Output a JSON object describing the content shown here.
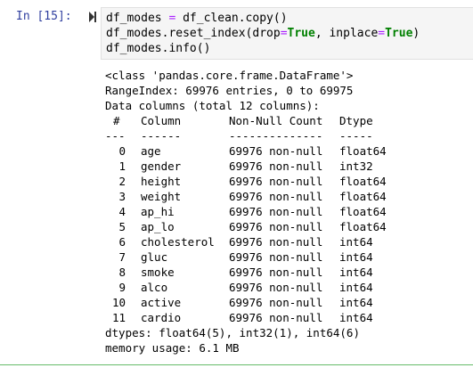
{
  "cell": {
    "prompt": "In [15]:",
    "code_lines": [
      "df_modes = df_clean.copy()",
      "df_modes.reset_index(drop=True, inplace=True)",
      "df_modes.info()"
    ]
  },
  "output": {
    "header_lines": [
      "<class 'pandas.core.frame.DataFrame'>",
      "RangeIndex: 69976 entries, 0 to 69975",
      "Data columns (total 12 columns):"
    ],
    "table": {
      "headers": [
        "#",
        "Column",
        "Non-Null Count",
        "Dtype"
      ],
      "separators": [
        "---",
        "------",
        "--------------",
        "-----"
      ],
      "rows": [
        [
          "0",
          "age",
          "69976 non-null",
          "float64"
        ],
        [
          "1",
          "gender",
          "69976 non-null",
          "int32"
        ],
        [
          "2",
          "height",
          "69976 non-null",
          "float64"
        ],
        [
          "3",
          "weight",
          "69976 non-null",
          "float64"
        ],
        [
          "4",
          "ap_hi",
          "69976 non-null",
          "float64"
        ],
        [
          "5",
          "ap_lo",
          "69976 non-null",
          "float64"
        ],
        [
          "6",
          "cholesterol",
          "69976 non-null",
          "int64"
        ],
        [
          "7",
          "gluc",
          "69976 non-null",
          "int64"
        ],
        [
          "8",
          "smoke",
          "69976 non-null",
          "int64"
        ],
        [
          "9",
          "alco",
          "69976 non-null",
          "int64"
        ],
        [
          "10",
          "active",
          "69976 non-null",
          "int64"
        ],
        [
          "11",
          "cardio",
          "69976 non-null",
          "int64"
        ]
      ]
    },
    "footer_lines": [
      "dtypes: float64(5), int32(1), int64(6)",
      "memory usage: 6.1 MB"
    ]
  },
  "colors": {
    "prompt": "#303f9f",
    "keyword_true": "#008000",
    "operator": "#aa22ff",
    "input_background": "#f5f5f5",
    "selected_cell_border": "#66bb6a"
  }
}
